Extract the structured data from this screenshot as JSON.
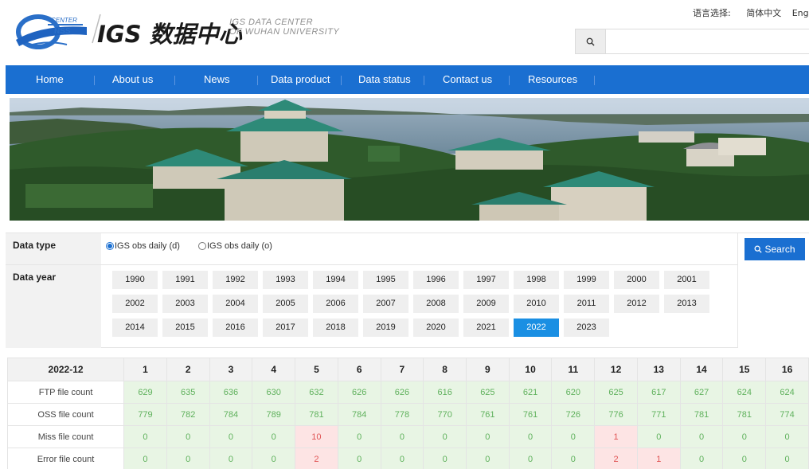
{
  "header": {
    "logo_center": "CENTER",
    "logo_nss": "NSS",
    "logo_cn": "IGS 数据中心",
    "logo_en_line1": "IGS DATA CENTER",
    "logo_en_line2": "OF WUHAN UNIVERSITY",
    "lang_label": "语言选择:",
    "lang_cn": "简体中文",
    "lang_en": "English",
    "search_placeholder": ""
  },
  "nav": {
    "items": [
      "Home",
      "About us",
      "News",
      "Data product",
      "Data status",
      "Contact us",
      "Resources"
    ]
  },
  "filter": {
    "data_type_label": "Data type",
    "data_year_label": "Data year",
    "radio_d": "IGS obs daily (d)",
    "radio_o": "IGS obs daily (o)",
    "selected_type": "d",
    "search_label": "Search",
    "years": [
      "1990",
      "1991",
      "1992",
      "1993",
      "1994",
      "1995",
      "1996",
      "1997",
      "1998",
      "1999",
      "2000",
      "2001",
      "2002",
      "2003",
      "2004",
      "2005",
      "2006",
      "2007",
      "2008",
      "2009",
      "2010",
      "2011",
      "2012",
      "2013",
      "2014",
      "2015",
      "2016",
      "2017",
      "2018",
      "2019",
      "2020",
      "2021",
      "2022",
      "2023"
    ],
    "selected_year": "2022"
  },
  "table": {
    "month": "2022-12",
    "days": [
      "1",
      "2",
      "3",
      "4",
      "5",
      "6",
      "7",
      "8",
      "9",
      "10",
      "11",
      "12",
      "13",
      "14",
      "15",
      "16"
    ],
    "rows": [
      {
        "label": "FTP file count",
        "values": [
          "629",
          "635",
          "636",
          "630",
          "632",
          "626",
          "626",
          "616",
          "625",
          "621",
          "620",
          "625",
          "617",
          "627",
          "624",
          "624"
        ]
      },
      {
        "label": "OSS file count",
        "values": [
          "779",
          "782",
          "784",
          "789",
          "781",
          "784",
          "778",
          "770",
          "761",
          "761",
          "726",
          "776",
          "771",
          "781",
          "781",
          "774"
        ]
      },
      {
        "label": "Miss file count",
        "values": [
          "0",
          "0",
          "0",
          "0",
          "10",
          "0",
          "0",
          "0",
          "0",
          "0",
          "0",
          "1",
          "0",
          "0",
          "0",
          "0"
        ]
      },
      {
        "label": "Error file count",
        "values": [
          "0",
          "0",
          "0",
          "0",
          "2",
          "0",
          "0",
          "0",
          "0",
          "0",
          "0",
          "2",
          "1",
          "0",
          "0",
          "0"
        ]
      }
    ]
  },
  "colors": {
    "nav_blue": "#1a6fd1",
    "ok_bg": "#e8f5e4",
    "ok_fg": "#5fb15c",
    "bad_bg": "#fde4e4",
    "bad_fg": "#e05555",
    "active_year": "#1a8fe3"
  }
}
